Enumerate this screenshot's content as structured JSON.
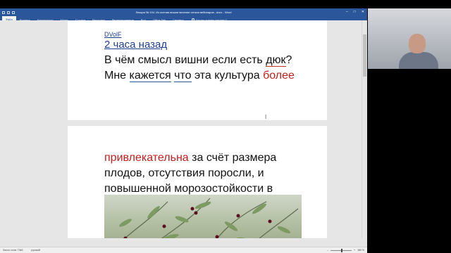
{
  "window": {
    "title": "Лекция № 194. Из осения вишни весение сеткия вебинаров...docx - Word",
    "controls": [
      "–",
      "□",
      "✕"
    ]
  },
  "ribbon": {
    "tabs": [
      "Файл",
      "Вставка",
      "Конструктор",
      "Макет",
      "Ссылки",
      "Рассылки",
      "Рецензирование",
      "Вид",
      "Office Tab",
      "Справка"
    ],
    "active_tab_index": 0,
    "tell_me": "Что вы хотите сделать?"
  },
  "doc_tab": {
    "label": "1. Из осения вишни весение сеткия вебинаров...docx *",
    "close": "×"
  },
  "page1": {
    "author": "DVolF",
    "time": "2 часа назад",
    "text_parts": {
      "p1": "В чём смысл вишни если есть ",
      "p2": "дюк",
      "p3": "? Мне ",
      "p4": "кажется",
      "p5": " ",
      "p6": "что",
      "p7": " эта культура ",
      "p8": "более"
    }
  },
  "page2": {
    "text_parts": {
      "p1": "привлекательна",
      "p2": " за счёт размера плодов, отсутствия поросли, и повышенной морозостойкости в отличие от черешни."
    }
  },
  "statusbar": {
    "word_count": "Число слов: 7346",
    "language": "русский",
    "zoom": "180 %"
  },
  "colors": {
    "accent": "#2b579a",
    "link": "#1f3f8f",
    "highlight_red": "#c21f1f"
  }
}
